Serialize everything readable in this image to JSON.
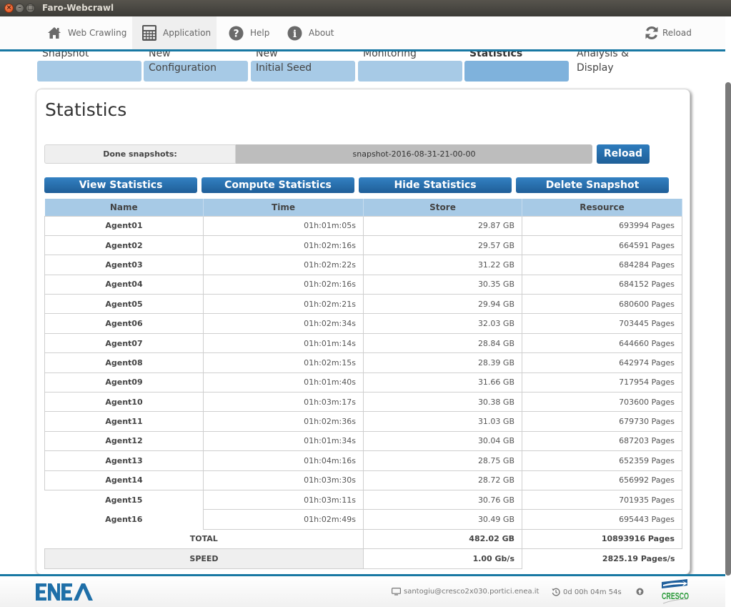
{
  "window": {
    "title": "Faro-Webcrawl"
  },
  "topnav": {
    "items": [
      {
        "label": "Web Crawling",
        "icon": "home-icon"
      },
      {
        "label": "Application",
        "icon": "calculator-icon",
        "active": true
      },
      {
        "label": "Help",
        "icon": "question-circle-icon"
      },
      {
        "label": "About",
        "icon": "info-circle-icon"
      }
    ],
    "reload_label": "Reload"
  },
  "steps": [
    {
      "line1": "Snapshot",
      "line2": ""
    },
    {
      "line1": "New",
      "line2": "Configuration"
    },
    {
      "line1": "New",
      "line2": "Initial Seed"
    },
    {
      "line1": "Monitoring",
      "line2": ""
    },
    {
      "line1": "Statistics",
      "line2": "",
      "active": true
    },
    {
      "line1": "Analysis &",
      "line2": "Display"
    }
  ],
  "panel": {
    "title": "Statistics",
    "snapshot_label": "Done snapshots:",
    "snapshot_value": "snapshot-2016-08-31-21-00-00",
    "reload_button": "Reload",
    "actions": [
      "View Statistics",
      "Compute Statistics",
      "Hide Statistics",
      "Delete Snapshot"
    ]
  },
  "table": {
    "headers": [
      "Name",
      "Time",
      "Store",
      "Resource"
    ],
    "rows": [
      [
        "Agent01",
        "01h:01m:05s",
        "29.87 GB",
        "693994 Pages"
      ],
      [
        "Agent02",
        "01h:02m:16s",
        "29.57 GB",
        "664591 Pages"
      ],
      [
        "Agent03",
        "01h:02m:22s",
        "31.22 GB",
        "684284 Pages"
      ],
      [
        "Agent04",
        "01h:02m:16s",
        "30.35 GB",
        "684152 Pages"
      ],
      [
        "Agent05",
        "01h:02m:21s",
        "29.94 GB",
        "680600 Pages"
      ],
      [
        "Agent06",
        "01h:02m:34s",
        "32.03 GB",
        "703445 Pages"
      ],
      [
        "Agent07",
        "01h:01m:14s",
        "28.84 GB",
        "644660 Pages"
      ],
      [
        "Agent08",
        "01h:02m:15s",
        "28.39 GB",
        "642974 Pages"
      ],
      [
        "Agent09",
        "01h:01m:40s",
        "31.66 GB",
        "717954 Pages"
      ],
      [
        "Agent10",
        "01h:03m:17s",
        "30.38 GB",
        "703600 Pages"
      ],
      [
        "Agent11",
        "01h:02m:36s",
        "31.03 GB",
        "679730 Pages"
      ],
      [
        "Agent12",
        "01h:01m:34s",
        "30.04 GB",
        "687203 Pages"
      ],
      [
        "Agent13",
        "01h:04m:16s",
        "28.75 GB",
        "652359 Pages"
      ],
      [
        "Agent14",
        "01h:03m:30s",
        "28.72 GB",
        "656992 Pages"
      ],
      [
        "Agent15",
        "01h:03m:11s",
        "30.76 GB",
        "701935 Pages"
      ],
      [
        "Agent16",
        "01h:02m:49s",
        "30.49 GB",
        "695443 Pages"
      ]
    ],
    "total": {
      "label": "TOTAL",
      "store": "482.02 GB",
      "resource": "10893916 Pages"
    },
    "speed": {
      "label": "SPEED",
      "store": "1.00 Gb/s",
      "resource": "2825.19 Pages/s"
    }
  },
  "footer": {
    "left_logo": "ENEA",
    "user_host": "santogiu@cresco2x030.portici.enea.it",
    "uptime": "0d 00h 04m 54s",
    "right_logo": "CRESCO"
  },
  "colors": {
    "accent": "#1878a3",
    "button": "#2a6fae",
    "tab": "#a7cae6",
    "tab_active": "#7fb2dc"
  }
}
